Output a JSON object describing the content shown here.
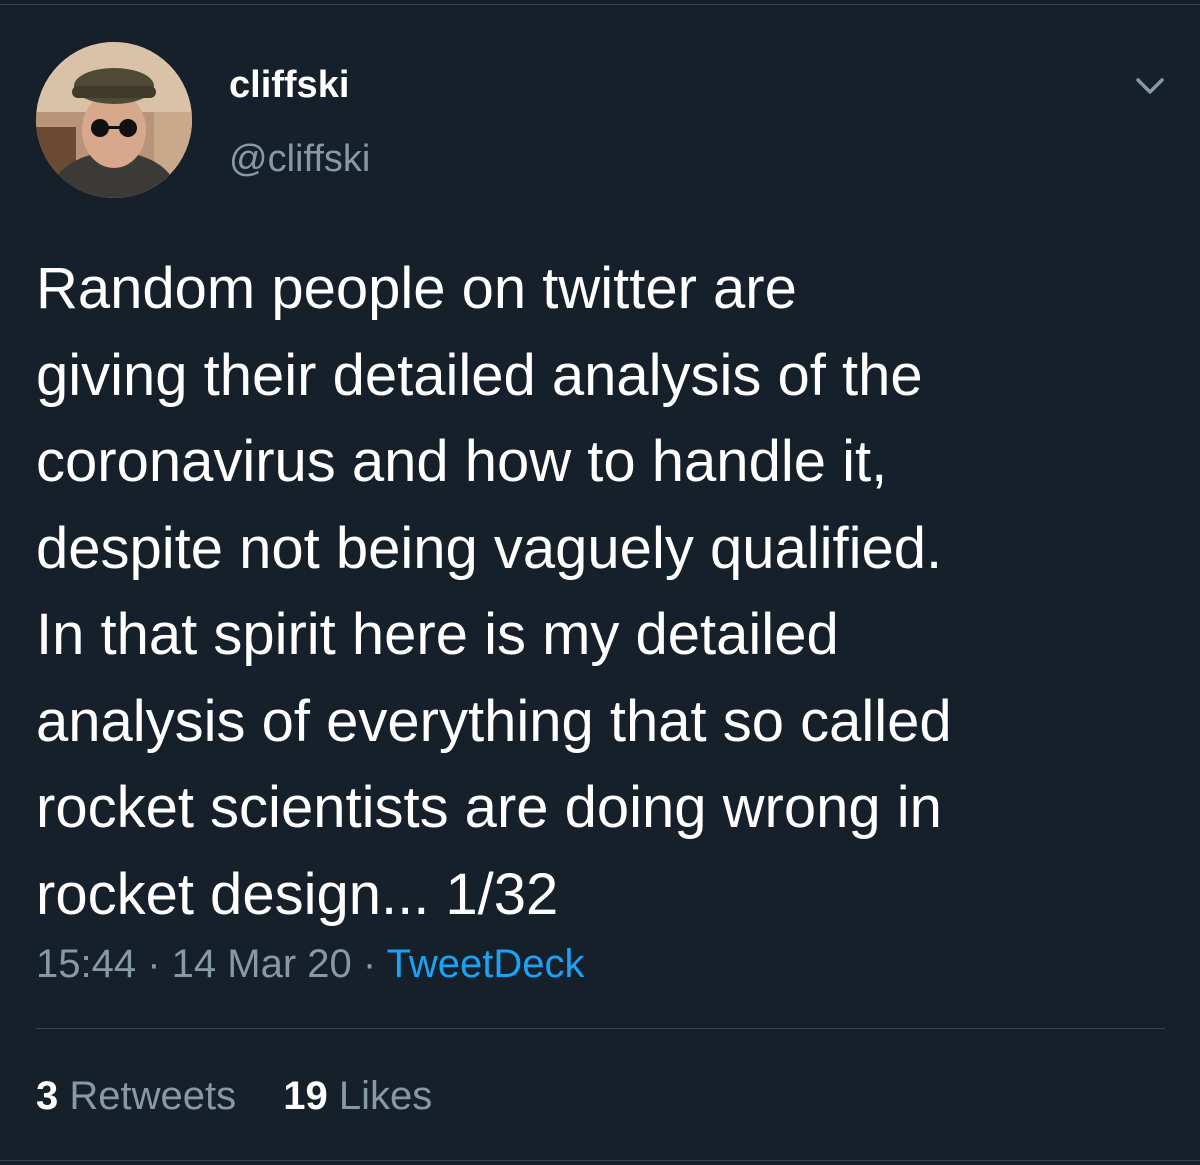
{
  "tweet": {
    "author": {
      "display_name": "cliffski",
      "handle": "@cliffski"
    },
    "text": "Random people on twitter are\ngiving their detailed analysis of the\ncoronavirus and how to handle it,\ndespite not being vaguely qualified.\nIn that spirit here is my detailed\nanalysis of everything that so called\nrocket scientists are doing wrong in\nrocket design... 1/32",
    "time": "15:44",
    "separator": " · ",
    "date": "14 Mar 20",
    "source": "TweetDeck",
    "stats": {
      "retweets_count": "3",
      "retweets_label": "Retweets",
      "likes_count": "19",
      "likes_label": "Likes"
    },
    "menu_icon": "chevron-down-icon"
  },
  "colors": {
    "background": "#15202b",
    "primary_text": "#ffffff",
    "secondary_text": "#8899a6",
    "link": "#1da1f2",
    "divider": "#38444d"
  }
}
